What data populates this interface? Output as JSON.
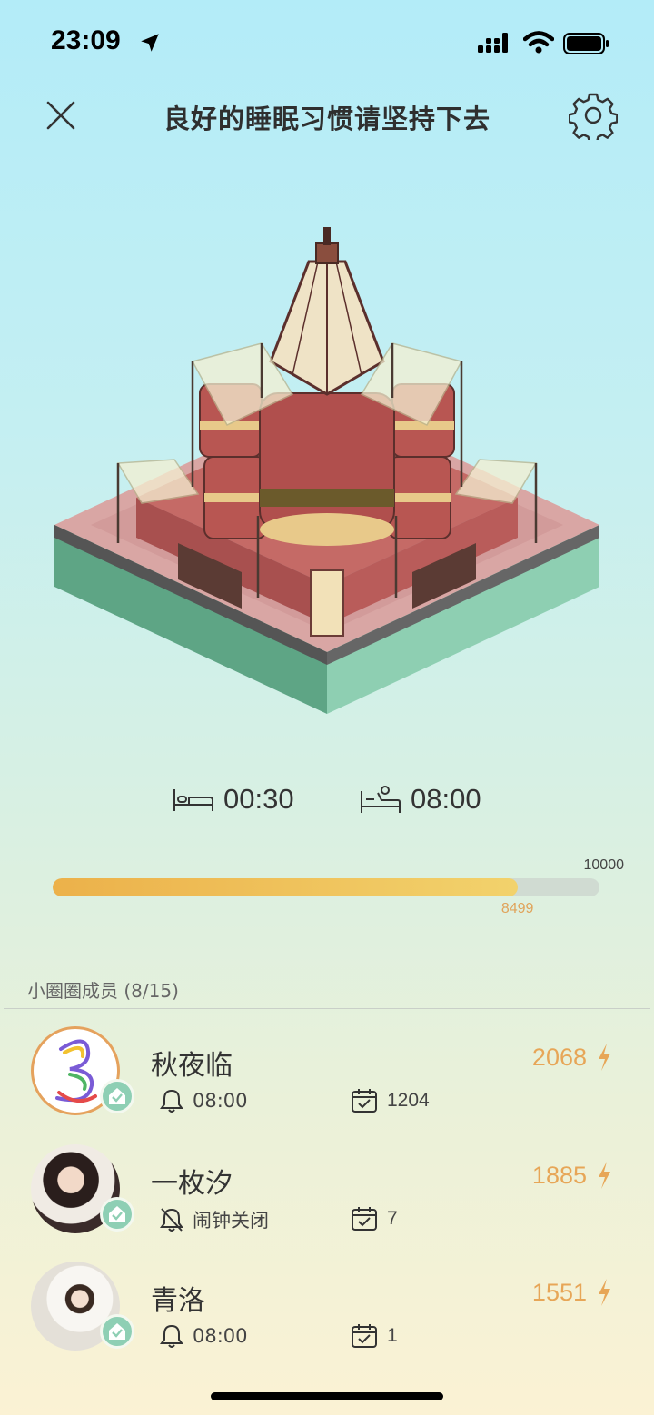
{
  "status_bar": {
    "time": "23:09"
  },
  "header": {
    "title": "良好的睡眠习惯请坚持下去"
  },
  "sleep": {
    "bed_time": "00:30",
    "wake_time": "08:00"
  },
  "progress": {
    "current": "8499",
    "max": "10000",
    "fraction": 0.8499
  },
  "members": {
    "title": "小圈圈成员 (8/15)",
    "items": [
      {
        "name": "秋夜临",
        "score": "2068",
        "alarm": "08:00",
        "days": "1204"
      },
      {
        "name": "一枚汐",
        "score": "1885",
        "alarm": "闹钟关闭",
        "days": "7"
      },
      {
        "name": "青洛",
        "score": "1551",
        "alarm": "08:00",
        "days": "1"
      }
    ]
  },
  "colors": {
    "accent": "#e7a657",
    "progress_start": "#ecb14a",
    "progress_end": "#f2d26c",
    "badge": "#8ecfb4"
  }
}
